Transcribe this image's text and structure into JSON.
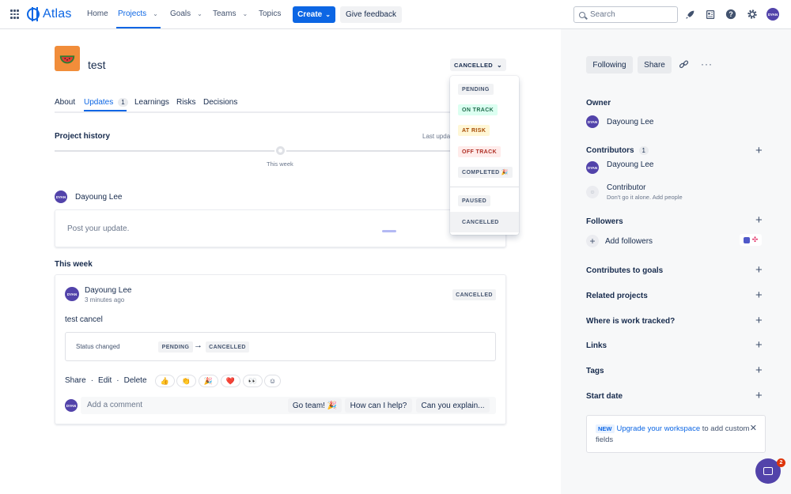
{
  "nav": {
    "logo": "Atlas",
    "items": [
      {
        "label": "Home"
      },
      {
        "label": "Projects"
      },
      {
        "label": "Goals"
      },
      {
        "label": "Teams"
      },
      {
        "label": "Topics"
      }
    ],
    "create_label": "Create",
    "feedback_label": "Give feedback",
    "search_placeholder": "Search",
    "user_initials": "DYAN"
  },
  "project": {
    "title": "test",
    "status": "CANCELLED",
    "icon": "watermelon-icon"
  },
  "tabs": [
    {
      "label": "About"
    },
    {
      "label": "Updates",
      "count": "1"
    },
    {
      "label": "Learnings"
    },
    {
      "label": "Risks"
    },
    {
      "label": "Decisions"
    }
  ],
  "history": {
    "title": "Project history",
    "last_update": "Last upda",
    "marker": "This week"
  },
  "post": {
    "author": "Dayoung Lee",
    "placeholder": "Post your update."
  },
  "this_week": {
    "title": "This week",
    "author": "Dayoung Lee",
    "time": "3 minutes ago",
    "status": "CANCELLED",
    "body": "test cancel",
    "status_changed_label": "Status changed",
    "from": "PENDING",
    "to": "CANCELLED",
    "actions": [
      "Share",
      "Edit",
      "Delete"
    ],
    "reactions": [
      "👍",
      "👏",
      "🎉",
      "❤️",
      "👀",
      "☺"
    ],
    "comment_placeholder": "Add a comment",
    "chips": [
      "Go team! 🎉",
      "How can I help?",
      "Can you explain..."
    ]
  },
  "status_menu": [
    {
      "label": "PENDING",
      "bg": "#f1f2f4",
      "fg": "#44546f"
    },
    {
      "label": "ON TRACK",
      "bg": "#dcfff1",
      "fg": "#216e4e"
    },
    {
      "label": "AT RISK",
      "bg": "#fff7d6",
      "fg": "#a54800"
    },
    {
      "label": "OFF TRACK",
      "bg": "#ffeceb",
      "fg": "#ae2e24"
    },
    {
      "label": "COMPLETED 🎉",
      "bg": "#f1f2f4",
      "fg": "#44546f"
    },
    {
      "label": "PAUSED",
      "bg": "#f1f2f4",
      "fg": "#44546f"
    },
    {
      "label": "CANCELLED",
      "bg": "#f1f2f4",
      "fg": "#44546f"
    }
  ],
  "sidebar": {
    "following_label": "Following",
    "share_label": "Share",
    "owner_title": "Owner",
    "owner_name": "Dayoung Lee",
    "contributors_title": "Contributors",
    "contributors_count": "1",
    "contributor_name": "Dayoung Lee",
    "contributor_placeholder": "Contributor",
    "contributor_hint": "Don't go it alone. Add people",
    "followers_title": "Followers",
    "add_followers": "Add followers",
    "sections": [
      "Contributes to goals",
      "Related projects",
      "Where is work tracked?",
      "Links",
      "Tags",
      "Start date"
    ],
    "upgrade_new": "NEW",
    "upgrade_link": "Upgrade your workspace",
    "upgrade_rest": "to add custom fields",
    "chat_badge": "2"
  },
  "colors": {
    "brand": "#0c66e4",
    "avatar": "#5243aa",
    "project_icon": "#f18d3a"
  }
}
